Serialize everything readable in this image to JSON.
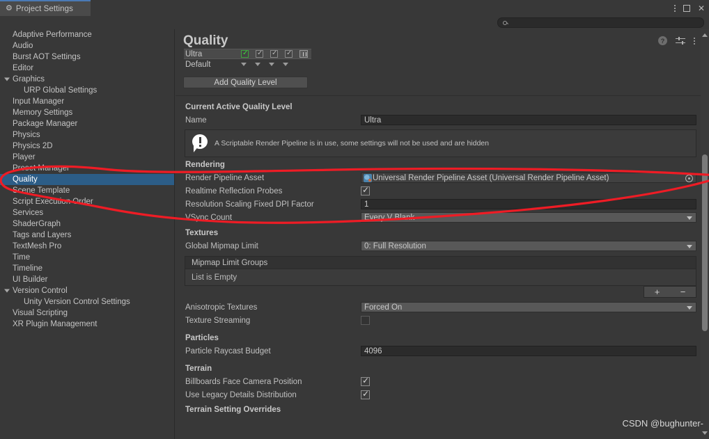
{
  "window": {
    "tab_label": "Project Settings",
    "tab_icon": "gear-icon",
    "menu_icon": "kebab-menu-icon",
    "maximize_icon": "maximize-icon",
    "close_icon": "close-icon"
  },
  "search": {
    "value": "",
    "placeholder": "",
    "icon": "search-icon"
  },
  "sidebar": {
    "items": [
      {
        "label": "Adaptive Performance",
        "indent": 0,
        "arrow": "none",
        "selected": false
      },
      {
        "label": "Audio",
        "indent": 0,
        "arrow": "none",
        "selected": false
      },
      {
        "label": "Burst AOT Settings",
        "indent": 0,
        "arrow": "none",
        "selected": false
      },
      {
        "label": "Editor",
        "indent": 0,
        "arrow": "none",
        "selected": false
      },
      {
        "label": "Graphics",
        "indent": 0,
        "arrow": "open",
        "selected": false
      },
      {
        "label": "URP Global Settings",
        "indent": 1,
        "arrow": "none",
        "selected": false
      },
      {
        "label": "Input Manager",
        "indent": 0,
        "arrow": "none",
        "selected": false
      },
      {
        "label": "Memory Settings",
        "indent": 0,
        "arrow": "none",
        "selected": false
      },
      {
        "label": "Package Manager",
        "indent": 0,
        "arrow": "none",
        "selected": false
      },
      {
        "label": "Physics",
        "indent": 0,
        "arrow": "none",
        "selected": false
      },
      {
        "label": "Physics 2D",
        "indent": 0,
        "arrow": "none",
        "selected": false
      },
      {
        "label": "Player",
        "indent": 0,
        "arrow": "none",
        "selected": false
      },
      {
        "label": "Preset Manager",
        "indent": 0,
        "arrow": "none",
        "selected": false
      },
      {
        "label": "Quality",
        "indent": 0,
        "arrow": "none",
        "selected": true
      },
      {
        "label": "Scene Template",
        "indent": 0,
        "arrow": "none",
        "selected": false
      },
      {
        "label": "Script Execution Order",
        "indent": 0,
        "arrow": "none",
        "selected": false
      },
      {
        "label": "Services",
        "indent": 0,
        "arrow": "none",
        "selected": false
      },
      {
        "label": "ShaderGraph",
        "indent": 0,
        "arrow": "none",
        "selected": false
      },
      {
        "label": "Tags and Layers",
        "indent": 0,
        "arrow": "none",
        "selected": false
      },
      {
        "label": "TextMesh Pro",
        "indent": 0,
        "arrow": "none",
        "selected": false
      },
      {
        "label": "Time",
        "indent": 0,
        "arrow": "none",
        "selected": false
      },
      {
        "label": "Timeline",
        "indent": 0,
        "arrow": "none",
        "selected": false
      },
      {
        "label": "UI Builder",
        "indent": 0,
        "arrow": "none",
        "selected": false
      },
      {
        "label": "Version Control",
        "indent": 0,
        "arrow": "open",
        "selected": false
      },
      {
        "label": "Unity Version Control Settings",
        "indent": 1,
        "arrow": "none",
        "selected": false
      },
      {
        "label": "Visual Scripting",
        "indent": 0,
        "arrow": "none",
        "selected": false
      },
      {
        "label": "XR Plugin Management",
        "indent": 0,
        "arrow": "none",
        "selected": false
      }
    ],
    "selected_color": "#2c5d87"
  },
  "panel": {
    "title": "Quality",
    "help_icon": "help-icon",
    "preset_icon": "preset-settings-icon",
    "menu_icon": "kebab-menu-icon",
    "quality_levels": [
      {
        "name": "Ultra",
        "active": true
      },
      {
        "name": "Default",
        "active": false
      }
    ],
    "add_quality_level_label": "Add Quality Level",
    "trash_icon": "trash-icon",
    "current_level_header": "Current Active Quality Level",
    "name_label": "Name",
    "name_value": "Ultra",
    "info_icon": "warning-icon",
    "info_text": "A Scriptable Render Pipeline is in use, some settings will not be used and are hidden",
    "sections": {
      "rendering": {
        "header": "Rendering",
        "render_pipeline_asset_label": "Render Pipeline Asset",
        "render_pipeline_asset_value": "Universal Render Pipeline Asset (Universal Render Pipeline Asset)",
        "render_pipeline_asset_icon": "asset-icon",
        "object_picker_icon": "object-picker-icon",
        "realtime_reflection_probes_label": "Realtime Reflection Probes",
        "realtime_reflection_probes_checked": true,
        "resolution_scaling_label": "Resolution Scaling Fixed DPI Factor",
        "resolution_scaling_value": "1",
        "vsync_count_label": "VSync Count",
        "vsync_count_value": "Every V Blank"
      },
      "textures": {
        "header": "Textures",
        "global_mipmap_limit_label": "Global Mipmap Limit",
        "global_mipmap_limit_value": "0: Full Resolution",
        "mipmap_limit_groups_label": "Mipmap Limit Groups",
        "list_empty_label": "List is Empty",
        "add_button_label": "+",
        "remove_button_label": "−",
        "anisotropic_textures_label": "Anisotropic Textures",
        "anisotropic_textures_value": "Forced On",
        "texture_streaming_label": "Texture Streaming",
        "texture_streaming_checked": false
      },
      "particles": {
        "header": "Particles",
        "particle_raycast_budget_label": "Particle Raycast Budget",
        "particle_raycast_budget_value": "4096"
      },
      "terrain": {
        "header": "Terrain",
        "billboards_label": "Billboards Face Camera Position",
        "billboards_checked": true,
        "legacy_details_label": "Use Legacy Details Distribution",
        "legacy_details_checked": true,
        "terrain_overrides_header": "Terrain Setting Overrides"
      }
    }
  },
  "annotation": {
    "color": "#ee1c25"
  },
  "watermark": "CSDN @bughunter-"
}
